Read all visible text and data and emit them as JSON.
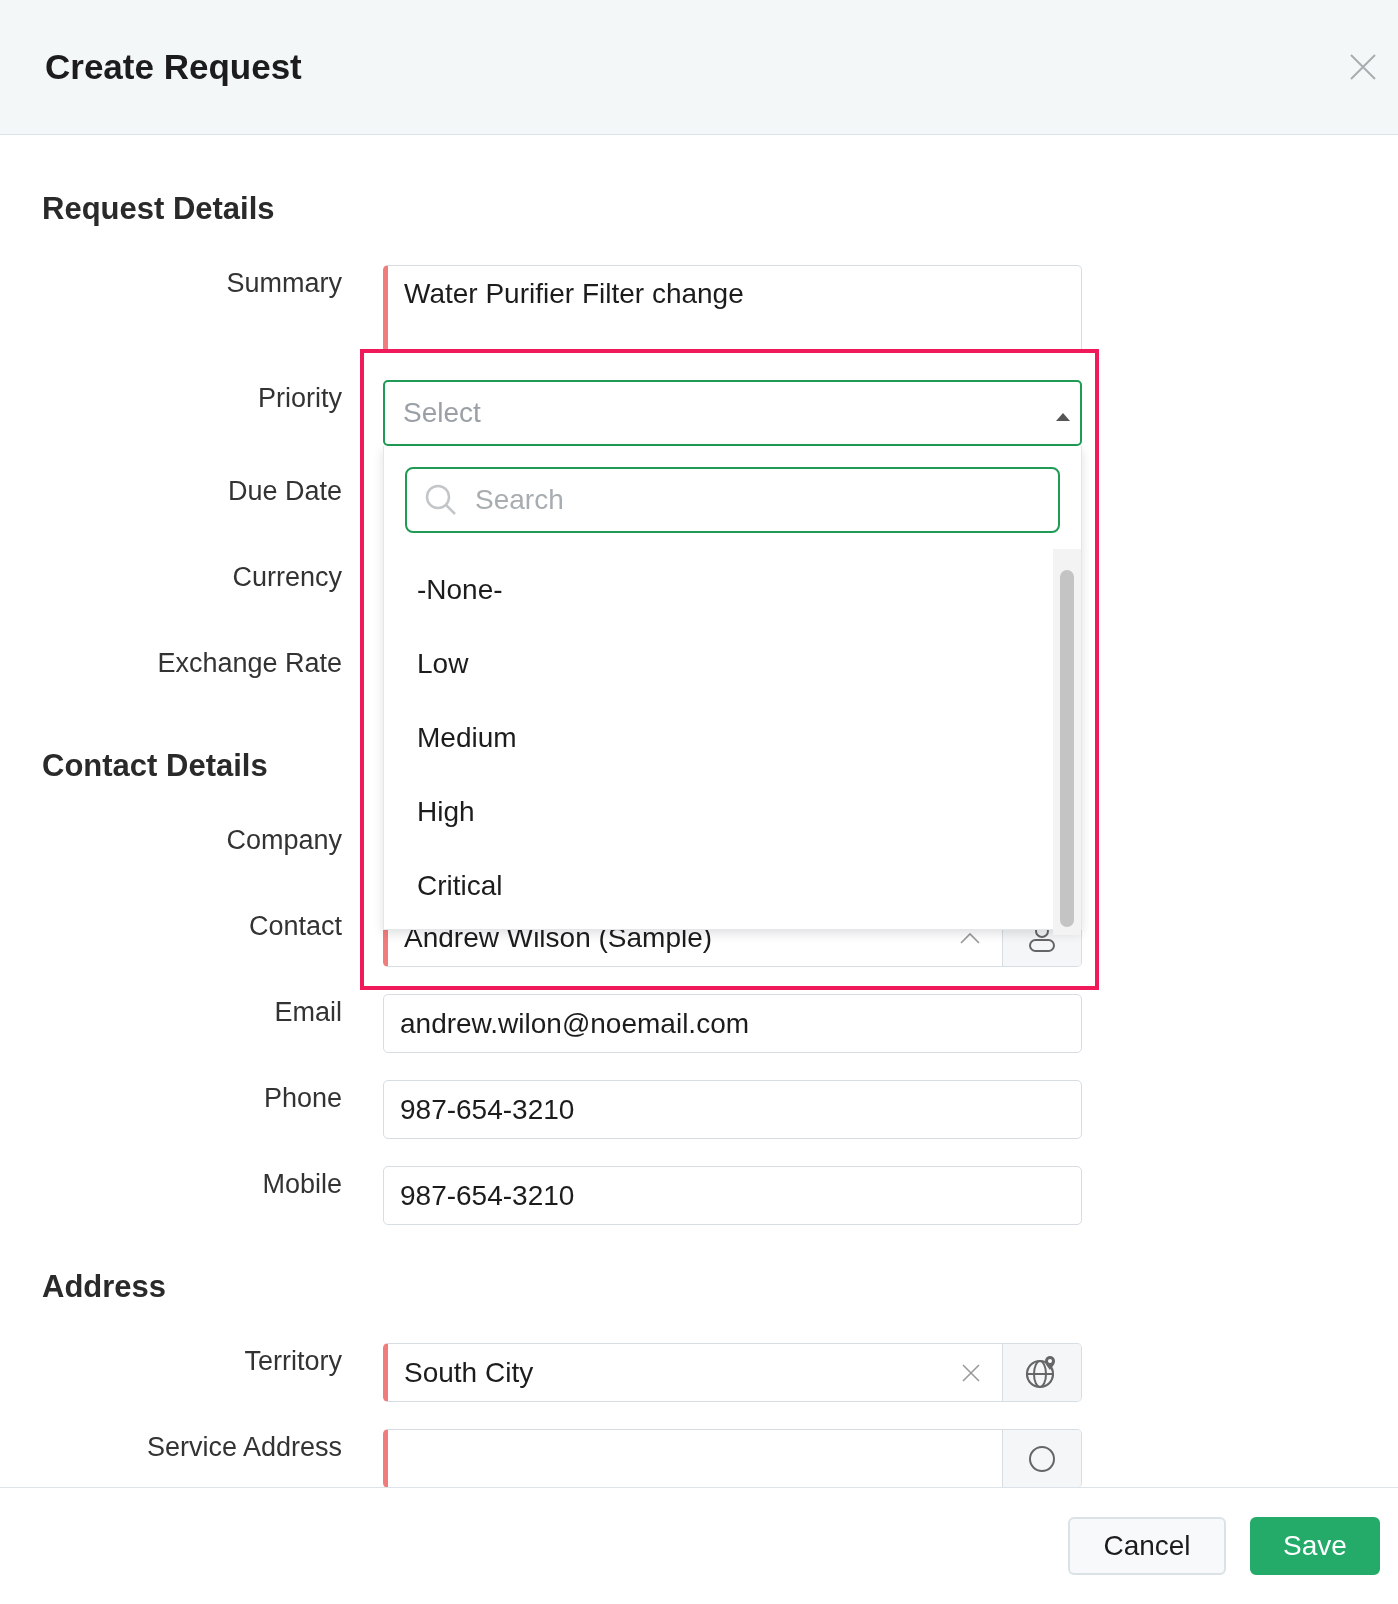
{
  "dialog": {
    "title": "Create Request"
  },
  "sections": [
    {
      "title": "Request Details",
      "fields": [
        {
          "label": "Summary",
          "kind": "textarea",
          "required": true,
          "value": "Water Purifier Filter change"
        },
        {
          "label": "Priority",
          "kind": "select",
          "required": false,
          "placeholder": "Select",
          "expanded": true,
          "highlighted": true,
          "dropdown": {
            "search_placeholder": "Search",
            "options": [
              {
                "label": "-None-",
                "selected": false
              },
              {
                "label": "Low",
                "selected": false
              },
              {
                "label": "Medium",
                "selected": false
              },
              {
                "label": "High",
                "selected": false
              },
              {
                "label": "Critical",
                "selected": false
              }
            ]
          }
        },
        {
          "label": "Due Date",
          "kind": "covered"
        },
        {
          "label": "Currency",
          "kind": "covered"
        },
        {
          "label": "Exchange Rate",
          "kind": "covered"
        }
      ]
    },
    {
      "title": "Contact Details",
      "fields": [
        {
          "label": "Company",
          "kind": "covered"
        },
        {
          "label": "Contact",
          "kind": "contact_lookup",
          "required": true,
          "value": "Andrew Wilson (Sample)"
        },
        {
          "label": "Email",
          "kind": "text",
          "required": false,
          "value": "andrew.wilon@noemail.com"
        },
        {
          "label": "Phone",
          "kind": "text",
          "required": false,
          "value": "987-654-3210"
        },
        {
          "label": "Mobile",
          "kind": "text",
          "required": false,
          "value": "987-654-3210"
        }
      ]
    },
    {
      "title": "Address",
      "fields": [
        {
          "label": "Territory",
          "kind": "territory_lookup",
          "required": true,
          "value": "South City"
        },
        {
          "label": "Service Address",
          "kind": "address_lookup",
          "required": true
        }
      ]
    }
  ],
  "footer": {
    "buttons": [
      {
        "label": "Cancel",
        "kind": "secondary"
      },
      {
        "label": "Save",
        "kind": "primary"
      }
    ]
  }
}
